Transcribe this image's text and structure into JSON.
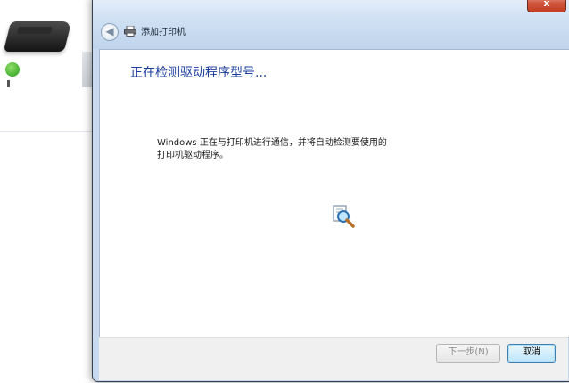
{
  "dialog": {
    "title": "添加打印机",
    "close_label": "x",
    "back_label": "◀",
    "heading": "正在检测驱动程序型号...",
    "description_line1": "Windows 正在与打印机进行通信，并将自动检测要使用的",
    "description_line2": "打印机驱动程序。",
    "next_label": "下一步(N)",
    "cancel_label": "取消",
    "next_enabled": false
  },
  "icons": {
    "back": "back-arrow-icon",
    "printer": "printer-icon",
    "search": "search-magnifier-icon",
    "background_printer": "printer-device-icon",
    "status": "status-check-icon"
  },
  "colors": {
    "heading": "#1b3d9c",
    "close_button": "#c23c22",
    "glass": "#c7daf0"
  }
}
